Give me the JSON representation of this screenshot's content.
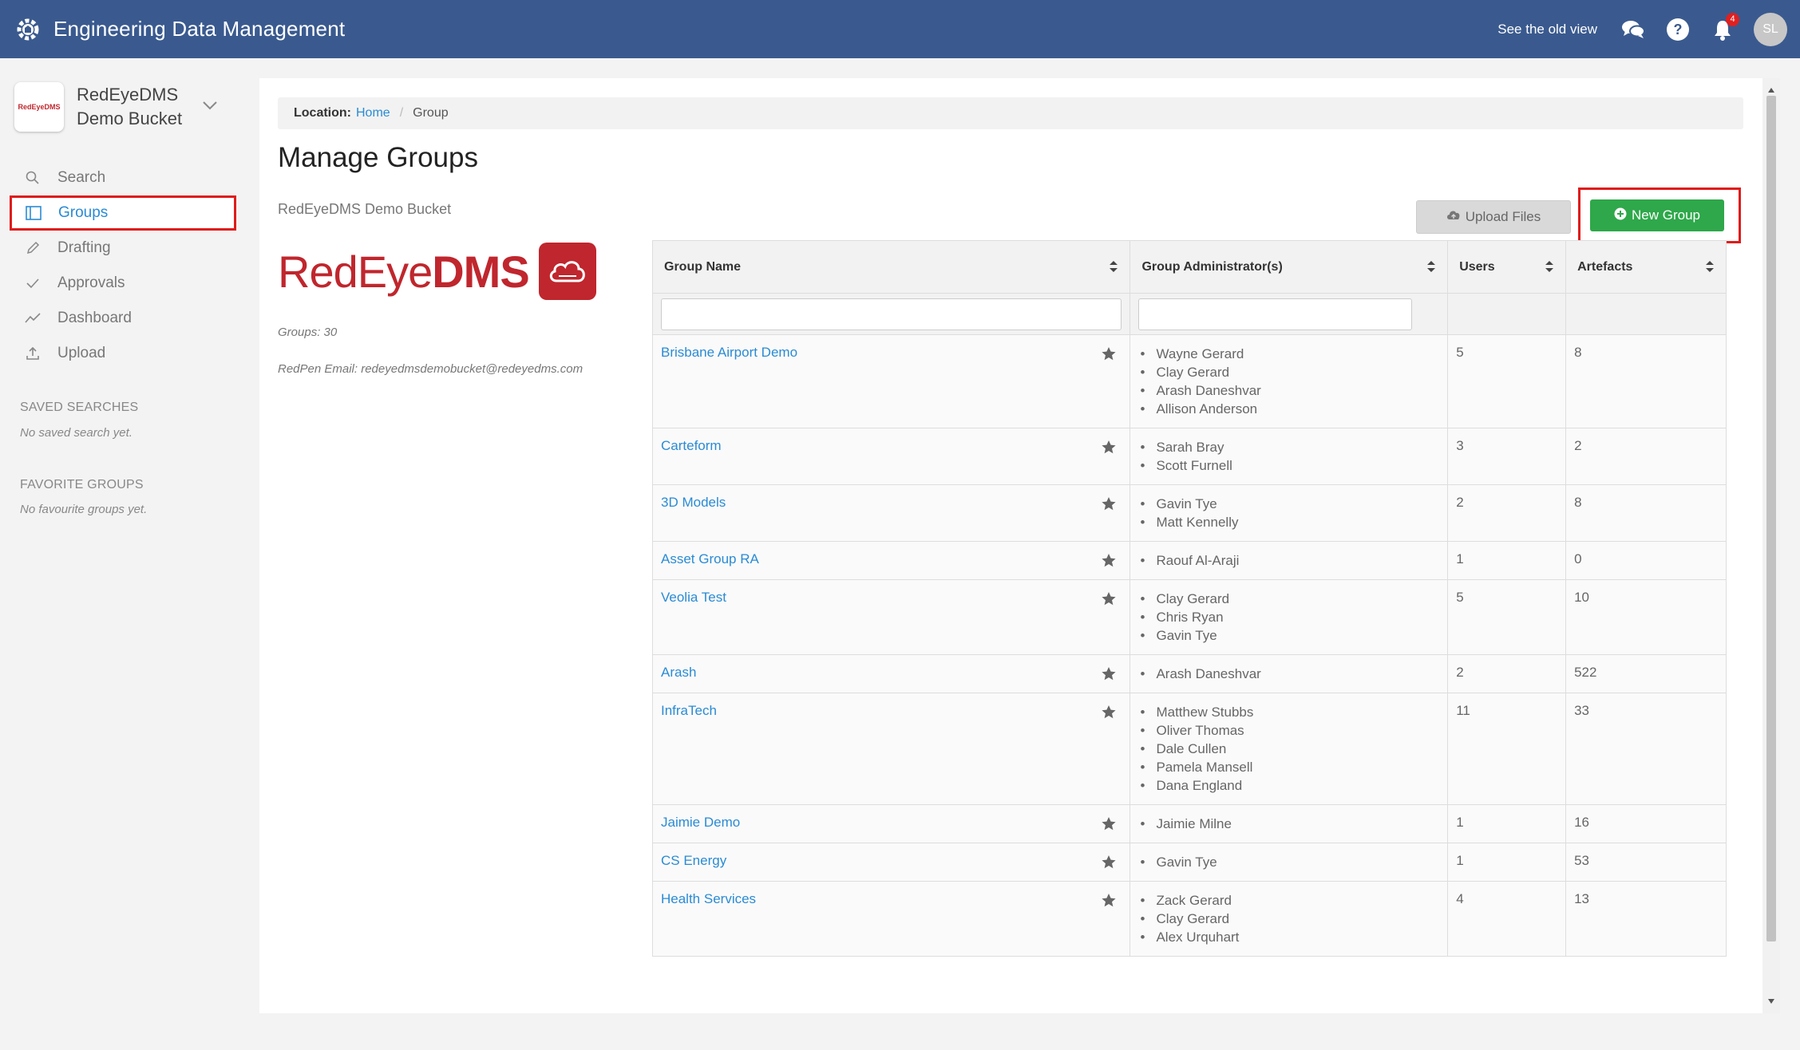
{
  "header": {
    "app_title": "Engineering Data Management",
    "old_view_link": "See the old view",
    "notification_count": "4",
    "avatar_initials": "SL"
  },
  "sidebar": {
    "bucket_logo_text": "RedEyeDMS",
    "bucket_name": "RedEyeDMS Demo Bucket",
    "items": [
      {
        "label": "Search",
        "icon": "search-icon"
      },
      {
        "label": "Groups",
        "icon": "groups-icon",
        "active": true
      },
      {
        "label": "Drafting",
        "icon": "pencil-icon"
      },
      {
        "label": "Approvals",
        "icon": "check-icon"
      },
      {
        "label": "Dashboard",
        "icon": "trend-icon"
      },
      {
        "label": "Upload",
        "icon": "upload-icon"
      }
    ],
    "saved_searches_title": "SAVED SEARCHES",
    "saved_searches_empty": "No saved search yet.",
    "favorite_groups_title": "FAVORITE GROUPS",
    "favorite_groups_empty": "No favourite groups yet."
  },
  "breadcrumb": {
    "label": "Location:",
    "home": "Home",
    "current": "Group"
  },
  "page": {
    "title": "Manage Groups",
    "bucket_subtitle": "RedEyeDMS Demo Bucket",
    "brand_red": "RedEye",
    "brand_dms": "DMS",
    "groups_count": "Groups: 30",
    "redpen_email": "RedPen Email: redeyedmsdemobucket@redeyedms.com",
    "upload_button": "Upload Files",
    "new_group_button": "New Group"
  },
  "table": {
    "headers": [
      "Group Name",
      "Group Administrator(s)",
      "Users",
      "Artefacts"
    ],
    "rows": [
      {
        "name": "Brisbane Airport Demo",
        "admins": [
          "Wayne Gerard",
          "Clay Gerard",
          "Arash Daneshvar",
          "Allison Anderson"
        ],
        "users": "5",
        "artefacts": "8"
      },
      {
        "name": "Carteform",
        "admins": [
          "Sarah Bray",
          "Scott Furnell"
        ],
        "users": "3",
        "artefacts": "2"
      },
      {
        "name": "3D Models",
        "admins": [
          "Gavin Tye",
          "Matt Kennelly"
        ],
        "users": "2",
        "artefacts": "8"
      },
      {
        "name": "Asset Group RA",
        "admins": [
          "Raouf Al-Araji"
        ],
        "users": "1",
        "artefacts": "0"
      },
      {
        "name": "Veolia Test",
        "admins": [
          "Clay Gerard",
          "Chris Ryan",
          "Gavin Tye"
        ],
        "users": "5",
        "artefacts": "10"
      },
      {
        "name": "Arash",
        "admins": [
          "Arash Daneshvar"
        ],
        "users": "2",
        "artefacts": "522"
      },
      {
        "name": "InfraTech",
        "admins": [
          "Matthew Stubbs",
          "Oliver Thomas",
          "Dale Cullen",
          "Pamela Mansell",
          "Dana England"
        ],
        "users": "11",
        "artefacts": "33"
      },
      {
        "name": "Jaimie Demo",
        "admins": [
          "Jaimie Milne"
        ],
        "users": "1",
        "artefacts": "16"
      },
      {
        "name": "CS Energy",
        "admins": [
          "Gavin Tye"
        ],
        "users": "1",
        "artefacts": "53"
      },
      {
        "name": "Health Services",
        "admins": [
          "Zack Gerard",
          "Clay Gerard",
          "Alex Urquhart"
        ],
        "users": "4",
        "artefacts": "13"
      }
    ]
  },
  "colors": {
    "header_bg": "#3a5a8f",
    "link": "#2a8bd4",
    "brand_red": "#c0262d",
    "primary_green": "#2ea84a",
    "highlight_red": "#e01b1b"
  }
}
